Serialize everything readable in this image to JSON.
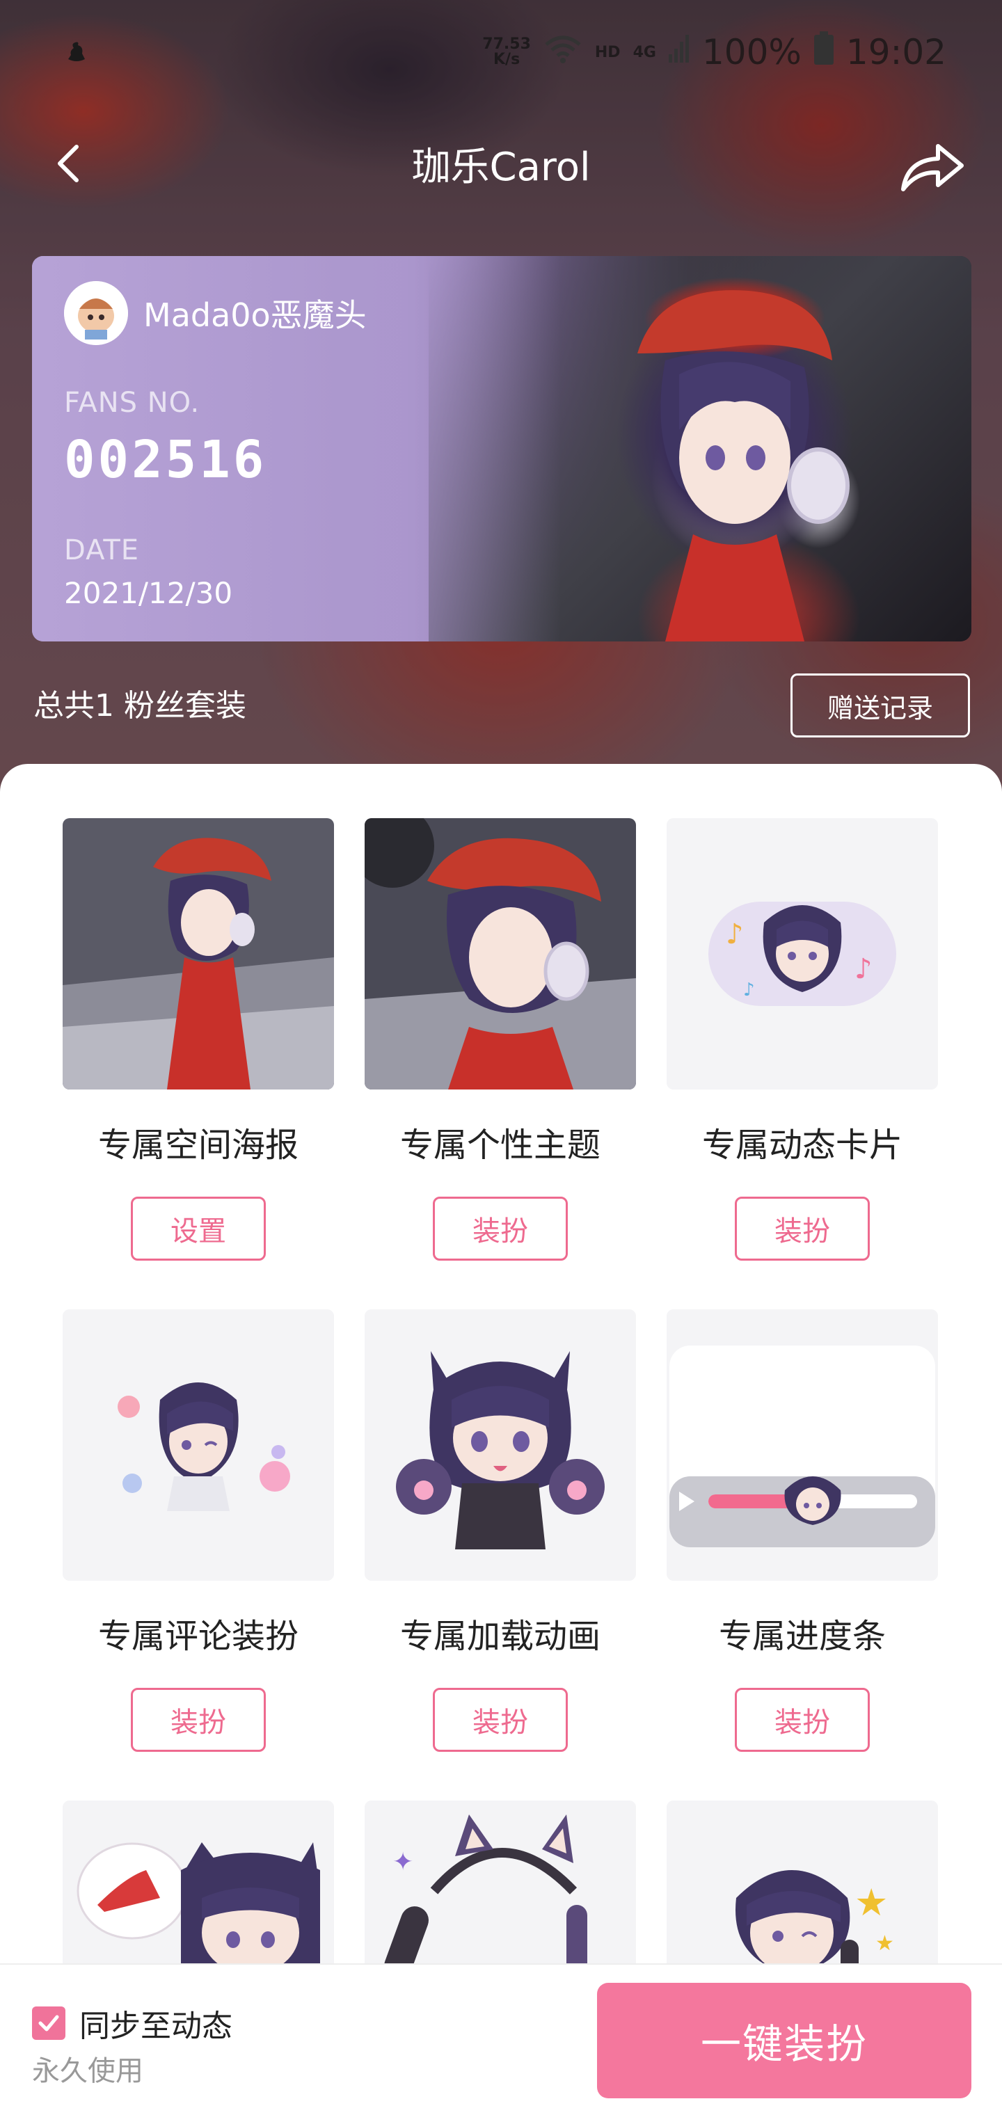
{
  "status_bar": {
    "net_speed_value": "77.53",
    "net_speed_unit": "K/s",
    "hd_label": "HD",
    "network": "4G",
    "battery": "100%",
    "time": "19:02"
  },
  "nav": {
    "title": "珈乐Carol"
  },
  "fan_card": {
    "username": "Mada0o恶魔头",
    "fans_no_label": "FANS NO.",
    "fans_no": "002516",
    "date_label": "DATE",
    "date": "2021/12/30"
  },
  "summary": {
    "suit_count": "总共1 粉丝套装",
    "gift_record": "赠送记录"
  },
  "items": [
    {
      "label": "专属空间海报",
      "button": "设置"
    },
    {
      "label": "专属个性主题",
      "button": "装扮"
    },
    {
      "label": "专属动态卡片",
      "button": "装扮"
    },
    {
      "label": "专属评论装扮",
      "button": "装扮"
    },
    {
      "label": "专属加载动画",
      "button": "装扮"
    },
    {
      "label": "专属进度条",
      "button": "装扮"
    },
    {
      "label": "",
      "button": ""
    },
    {
      "label": "",
      "button": ""
    },
    {
      "label": "",
      "button": ""
    }
  ],
  "bottom": {
    "sync_label": "同步至动态",
    "sync_checked": true,
    "permanent": "永久使用",
    "apply_button": "一键装扮"
  },
  "colors": {
    "accent_pink": "#f4779d",
    "button_border_pink": "#ee6a8f"
  }
}
